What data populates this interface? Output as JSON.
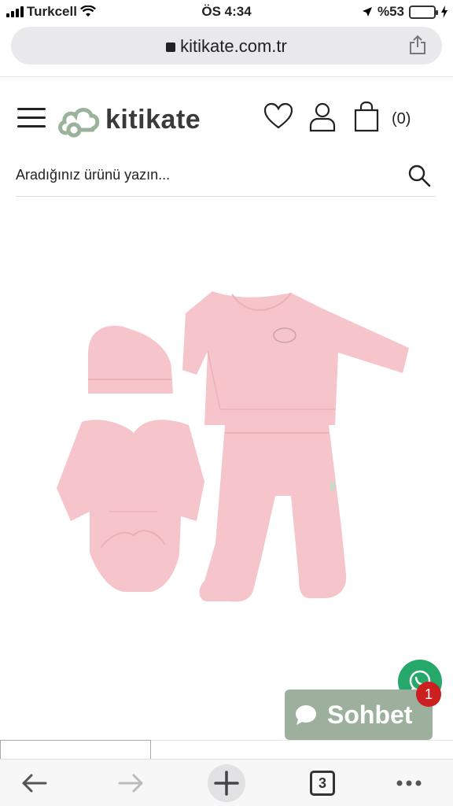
{
  "status_bar": {
    "carrier": "Turkcell",
    "time": "ÖS 4:34",
    "battery": "%53",
    "battery_level": 0.53
  },
  "browser": {
    "url": "kitikate.com.tr",
    "open_tabs": "3"
  },
  "header": {
    "brand": "kitikate",
    "cart_count": "(0)"
  },
  "search": {
    "placeholder": "Aradığınız ürünü yazın..."
  },
  "chat": {
    "label": "Sohbet",
    "badge": "1"
  },
  "colors": {
    "product_pink": "#f6c4cb",
    "whatsapp_green": "#25a86a",
    "chat_bg": "#9db09d",
    "badge_red": "#cc1f1f"
  }
}
